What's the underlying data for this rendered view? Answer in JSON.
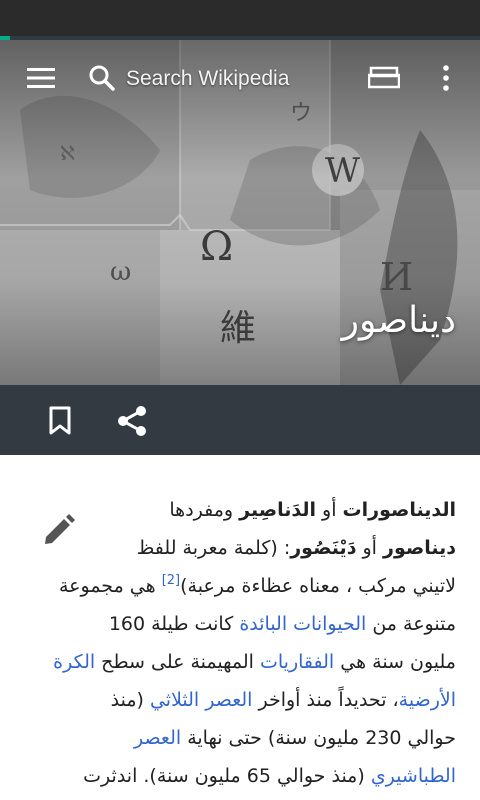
{
  "page_load_progress": 0.02,
  "colors": {
    "progress": "#00af89",
    "action_bar": "#333a41",
    "link": "#3366cc",
    "text": "#222222"
  },
  "toolbar": {
    "menu_icon": "hamburger-menu-icon",
    "search_icon": "search-icon",
    "search_placeholder": "Search Wikipedia",
    "tabs_icon": "tabs-icon",
    "more_icon": "overflow-menu-icon"
  },
  "article": {
    "title": "ديناصور",
    "lead_lines": [
      [
        {
          "type": "bold",
          "text": "الديناصورات"
        },
        {
          "type": "text",
          "text": " أو "
        },
        {
          "type": "bold",
          "text": "الدَناصِير"
        },
        {
          "type": "text",
          "text": " ومفردها"
        }
      ],
      [
        {
          "type": "bold",
          "text": "ديناصور"
        },
        {
          "type": "text",
          "text": " أو "
        },
        {
          "type": "bold",
          "text": "دَيْنَصُور"
        },
        {
          "type": "text",
          "text": ": (كلمة معربة للفظ"
        }
      ],
      [
        {
          "type": "text",
          "text": "لاتيني مركب ، معناه عظاءة مرعبة)"
        },
        {
          "type": "ref",
          "text": "[2]"
        },
        {
          "type": "text",
          "text": " هي مجموعة"
        }
      ],
      [
        {
          "type": "text",
          "text": "متنوعة من "
        },
        {
          "type": "link",
          "text": "الحيوانات البائدة"
        },
        {
          "type": "text",
          "text": " كانت طيلة 160"
        }
      ],
      [
        {
          "type": "text",
          "text": "مليون سنة هي "
        },
        {
          "type": "link",
          "text": "الفقاريات"
        },
        {
          "type": "text",
          "text": " المهيمنة على سطح "
        },
        {
          "type": "link",
          "text": "الكرة"
        }
      ],
      [
        {
          "type": "link",
          "text": "الأرضية"
        },
        {
          "type": "text",
          "text": "، تحديداً منذ أواخر "
        },
        {
          "type": "link",
          "text": "العصر الثلاثي"
        },
        {
          "type": "text",
          "text": " (منذ"
        }
      ],
      [
        {
          "type": "text",
          "text": "حوالي 230 مليون سنة) حتى نهاية "
        },
        {
          "type": "link",
          "text": "العصر"
        }
      ],
      [
        {
          "type": "link",
          "text": "الطباشيري"
        },
        {
          "type": "text",
          "text": " (منذ حوالي 65 مليون سنة). اندثرت"
        }
      ]
    ]
  },
  "actions": {
    "bookmark_icon": "bookmark-icon",
    "share_icon": "share-icon",
    "edit_icon": "edit-pencil-icon"
  }
}
